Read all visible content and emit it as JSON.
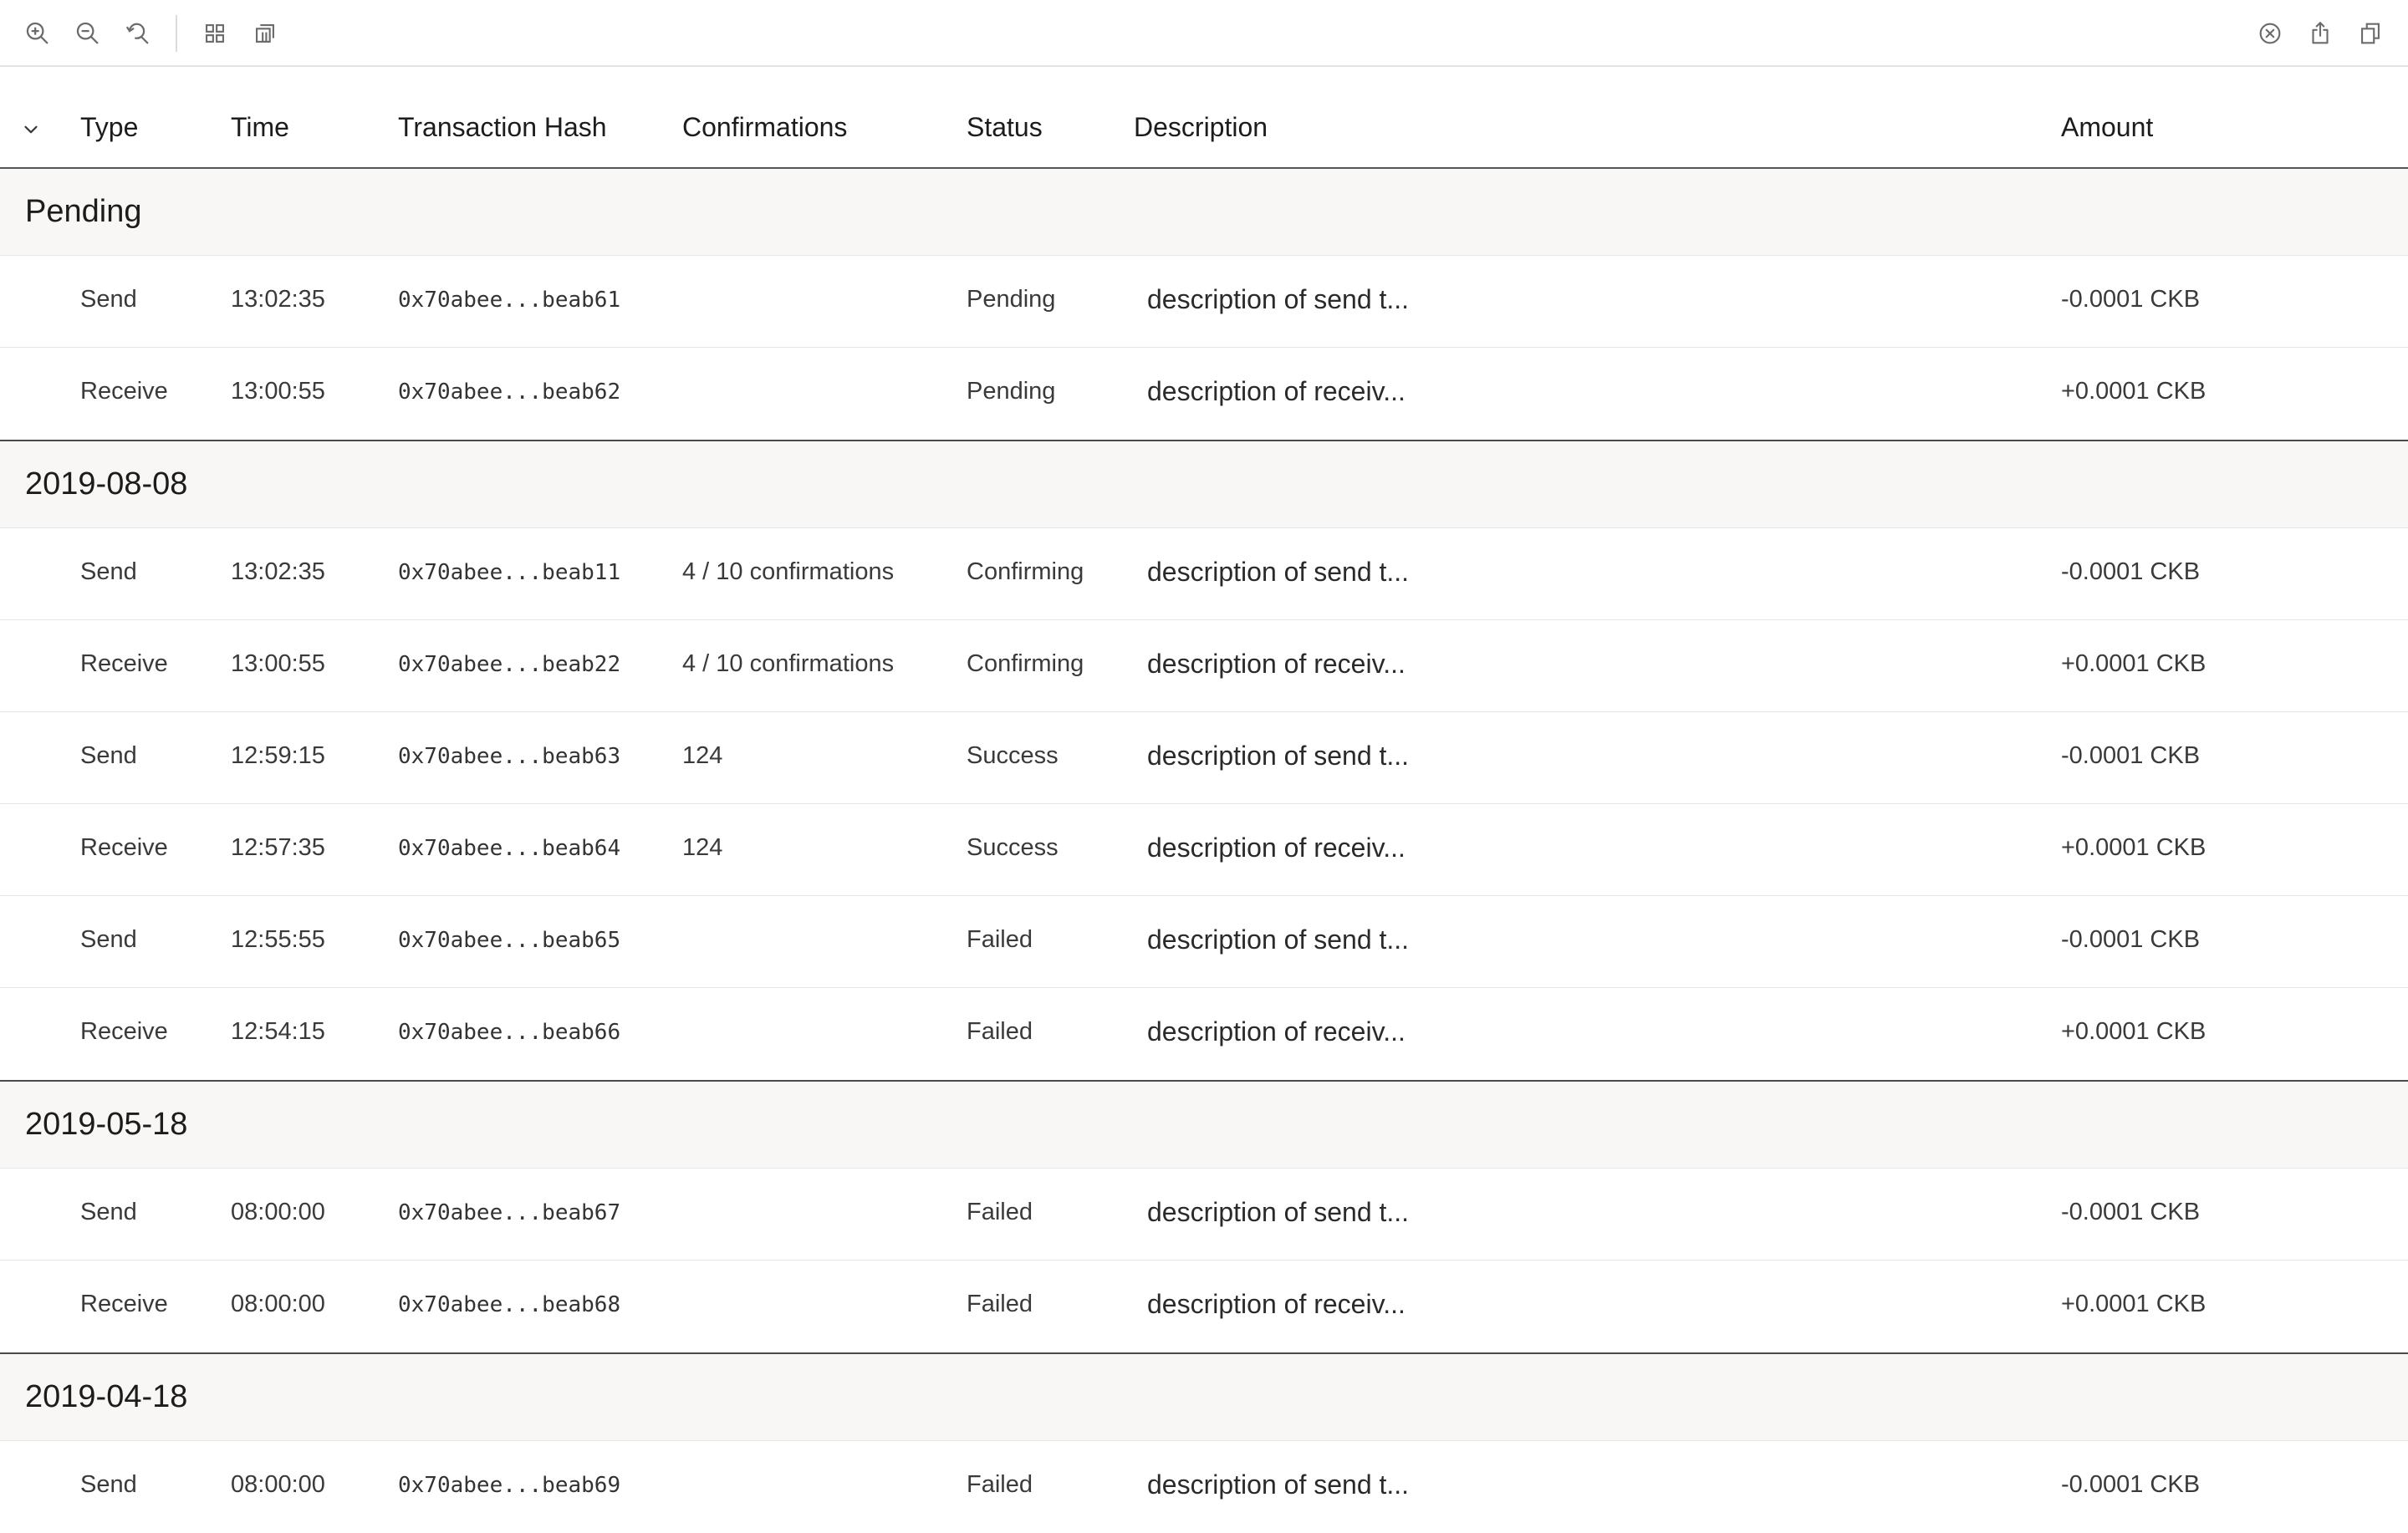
{
  "toolbar": {
    "left_icons": [
      "zoom-in-icon",
      "zoom-out-icon",
      "reset-zoom-icon",
      "grid-view-icon",
      "fit-view-icon"
    ],
    "right_icons": [
      "close-icon",
      "share-icon",
      "copy-icon"
    ]
  },
  "columns": {
    "type": "Type",
    "time": "Time",
    "hash": "Transaction Hash",
    "confirmations": "Confirmations",
    "status": "Status",
    "description": "Description",
    "amount": "Amount"
  },
  "groups": [
    {
      "title": "Pending",
      "rows": [
        {
          "type": "Send",
          "time": "13:02:35",
          "hash": "0x70abee...beab61",
          "confirmations": "",
          "status": "Pending",
          "description": "description of send t...",
          "amount": "-0.0001 CKB"
        },
        {
          "type": "Receive",
          "time": "13:00:55",
          "hash": "0x70abee...beab62",
          "confirmations": "",
          "status": "Pending",
          "description": "description of receiv...",
          "amount": "+0.0001 CKB"
        }
      ]
    },
    {
      "title": "2019-08-08",
      "rows": [
        {
          "type": "Send",
          "time": "13:02:35",
          "hash": "0x70abee...beab11",
          "confirmations": "4 / 10 confirmations",
          "status": "Confirming",
          "description": "description of send t...",
          "amount": "-0.0001 CKB"
        },
        {
          "type": "Receive",
          "time": "13:00:55",
          "hash": "0x70abee...beab22",
          "confirmations": "4 / 10 confirmations",
          "status": "Confirming",
          "description": "description of receiv...",
          "amount": "+0.0001 CKB"
        },
        {
          "type": "Send",
          "time": "12:59:15",
          "hash": "0x70abee...beab63",
          "confirmations": "124",
          "status": "Success",
          "description": "description of send t...",
          "amount": "-0.0001 CKB"
        },
        {
          "type": "Receive",
          "time": "12:57:35",
          "hash": "0x70abee...beab64",
          "confirmations": "124",
          "status": "Success",
          "description": "description of receiv...",
          "amount": "+0.0001 CKB"
        },
        {
          "type": "Send",
          "time": "12:55:55",
          "hash": "0x70abee...beab65",
          "confirmations": "",
          "status": "Failed",
          "description": "description of send t...",
          "amount": "-0.0001 CKB"
        },
        {
          "type": "Receive",
          "time": "12:54:15",
          "hash": "0x70abee...beab66",
          "confirmations": "",
          "status": "Failed",
          "description": "description of receiv...",
          "amount": "+0.0001 CKB"
        }
      ]
    },
    {
      "title": "2019-05-18",
      "rows": [
        {
          "type": "Send",
          "time": "08:00:00",
          "hash": "0x70abee...beab67",
          "confirmations": "",
          "status": "Failed",
          "description": "description of send t...",
          "amount": "-0.0001 CKB"
        },
        {
          "type": "Receive",
          "time": "08:00:00",
          "hash": "0x70abee...beab68",
          "confirmations": "",
          "status": "Failed",
          "description": "description of receiv...",
          "amount": "+0.0001 CKB"
        }
      ]
    },
    {
      "title": "2019-04-18",
      "rows": [
        {
          "type": "Send",
          "time": "08:00:00",
          "hash": "0x70abee...beab69",
          "confirmations": "",
          "status": "Failed",
          "description": "description of send t...",
          "amount": "-0.0001 CKB"
        }
      ]
    }
  ]
}
